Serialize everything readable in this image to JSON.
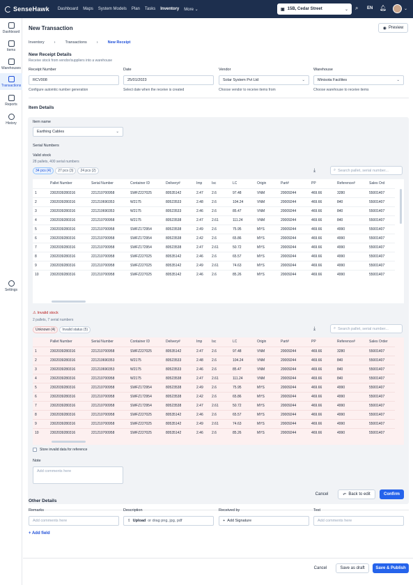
{
  "app": {
    "logo_text": "SenseHawk",
    "nav": [
      {
        "label": "Dashboard"
      },
      {
        "label": "Maps"
      },
      {
        "label": "System Models"
      },
      {
        "label": "Plan"
      },
      {
        "label": "Tasks"
      },
      {
        "label": "Inventory",
        "active": true
      },
      {
        "label": "More"
      }
    ],
    "project": "15B, Cedar Street",
    "language": "EN"
  },
  "sidebar": [
    {
      "label": "Dashboard",
      "icon": "dashboard-icon"
    },
    {
      "label": "Items",
      "icon": "cube-icon"
    },
    {
      "label": "Warehouses",
      "icon": "warehouse-icon"
    },
    {
      "label": "Transactions",
      "icon": "truck-icon",
      "active": true
    },
    {
      "label": "Reports",
      "icon": "report-icon"
    },
    {
      "label": "History",
      "icon": "history-icon"
    },
    {
      "label": "Settings",
      "icon": "gear-icon"
    }
  ],
  "page": {
    "title": "New Transaction",
    "preview": "Preview",
    "breadcrumb": [
      "Inventory",
      "Transactions",
      "New Receipt"
    ]
  },
  "receipt": {
    "title": "New Receipt Details",
    "subtitle": "Receive stock from vendor/suppliers into a warehouse",
    "receipt_number": {
      "label": "Receipt Number",
      "value": "RCV008",
      "hint": "Configure automtic number generation"
    },
    "date": {
      "label": "Date",
      "value": "25/01/2023",
      "hint": "Select date when the receive is created"
    },
    "vendor": {
      "label": "Vendor",
      "value": "Solar System Pvt Ltd",
      "hint": "Choose vendor to receive items from"
    },
    "warehouse": {
      "label": "Warehouse",
      "value": "Minisota Facilites",
      "hint": "Choose warehouse to receive items"
    }
  },
  "item_details": {
    "title": "Item Details",
    "item_name_label": "Item name",
    "item_name": "Earthing Cables",
    "serial_numbers": "Serial Numbers",
    "valid": {
      "title": "Valid stock",
      "summary": "28 pallets, 400 serial numbers",
      "chips": [
        "34 pcs (4)",
        "27 pcs (3)",
        "24 pcs (2)"
      ],
      "search_placeholder": "Search pallet, serial number..."
    },
    "invalid": {
      "title": "Invalid stock",
      "summary": "2 pallets, 7 serial numbers",
      "chips": [
        "Unknown (4)",
        "Invalid status (5)"
      ],
      "search_placeholder": "Search pallet, serial number..."
    },
    "store_invalid": "Store invalid data for reference",
    "note_label": "Note",
    "note_placeholder": "Add comments here",
    "cancel": "Cancel",
    "back_to_edit": "Back to edit",
    "confirm": "Confirm"
  },
  "table": {
    "columns": [
      "",
      "Pallet Number",
      "Serial Number",
      "Container ID",
      "Delivery#",
      "Imp",
      "Isc",
      "LC",
      "Origin",
      "Part#",
      "PP",
      "Reference#",
      "Sales Ord"
    ],
    "invalid_columns": [
      "",
      "Pallet Number",
      "Serial Number",
      "Container ID",
      "Delivery#",
      "Imp",
      "Isc",
      "LC",
      "Origin",
      "Part#",
      "PP",
      "Reference#",
      "Sales Order"
    ],
    "rows": [
      [
        "1",
        "2302039280316",
        "221210700958",
        "SWFZ227025",
        "80535142",
        "2.47",
        "2.6",
        "97.48",
        "VNM",
        "20009244",
        "469.66",
        "3280",
        "55001407"
      ],
      [
        "2",
        "2302039280316",
        "221210690353",
        "W2175",
        "80523533",
        "2.48",
        "2.6",
        "104.24",
        "VNM",
        "20009244",
        "469.66",
        "840",
        "55001407"
      ],
      [
        "3",
        "2302039280316",
        "221210690353",
        "W2175",
        "80523533",
        "2.46",
        "2.6",
        "85.47",
        "VNM",
        "20009244",
        "469.66",
        "840",
        "55001407"
      ],
      [
        "4",
        "2302039280316",
        "221210700958",
        "W2175",
        "80523538",
        "2.47",
        "2.61",
        "111.24",
        "VNM",
        "20009244",
        "469.66",
        "840",
        "55001407"
      ],
      [
        "5",
        "2302039280316",
        "221210700958",
        "SWFZ172954",
        "80523538",
        "2.49",
        "2.6",
        "75.95",
        "MYS",
        "20009244",
        "469.66",
        "4990",
        "55001407"
      ],
      [
        "6",
        "2302039280316",
        "221210700958",
        "SWFZ172954",
        "80523538",
        "2.42",
        "2.6",
        "65.86",
        "MYS",
        "20009244",
        "469.66",
        "4990",
        "55001407"
      ],
      [
        "7",
        "2302039280316",
        "221210700958",
        "SWFZ172954",
        "80523538",
        "2.47",
        "2.61",
        "50.72",
        "MYS",
        "20009244",
        "469.66",
        "4990",
        "55001407"
      ],
      [
        "8",
        "2302039280316",
        "221210700958",
        "SWFZ227025",
        "80535142",
        "2.46",
        "2.6",
        "65.57",
        "MYS",
        "20009244",
        "469.66",
        "4990",
        "55001407"
      ],
      [
        "9",
        "2302039280316",
        "221210700958",
        "SWFZ227025",
        "80535142",
        "2.49",
        "2.61",
        "74.63",
        "MYS",
        "20009244",
        "469.66",
        "4990",
        "55001407"
      ],
      [
        "10",
        "2302039280316",
        "221210700958",
        "SWFZ227025",
        "80535142",
        "2.46",
        "2.6",
        "85.26",
        "MYS",
        "20009244",
        "469.66",
        "4990",
        "55001407"
      ]
    ]
  },
  "other": {
    "title": "Other Details",
    "remarks": {
      "label": "Remarks",
      "placeholder": "Add comments here"
    },
    "description": {
      "label": "Description",
      "upload": "Upload",
      "rest": "or drag png, jpg, pdf"
    },
    "received_by": {
      "label": "Received by",
      "button": "Add Signature"
    },
    "test": {
      "label": "Test",
      "placeholder": "Add comments here"
    },
    "add_field": "Add field"
  },
  "footer": {
    "cancel": "Cancel",
    "draft": "Save as draft",
    "publish": "Save & Publish"
  }
}
